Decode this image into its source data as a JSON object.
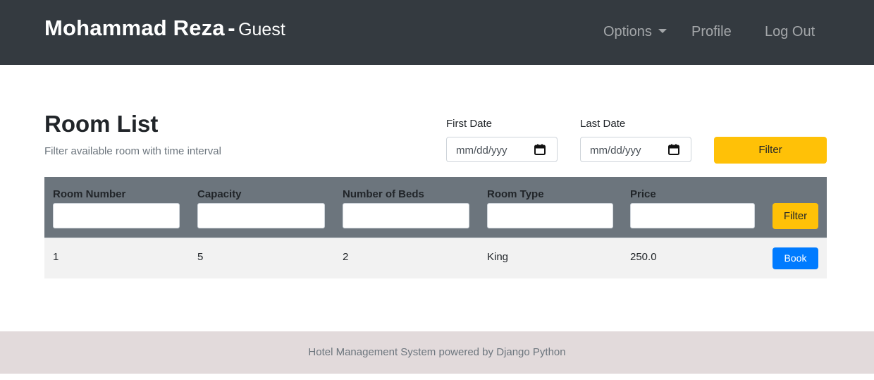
{
  "navbar": {
    "brand_name": "Mohammad Reza",
    "brand_separator": "-",
    "brand_role": "Guest",
    "options_label": "Options",
    "profile_label": "Profile",
    "logout_label": "Log Out"
  },
  "header": {
    "title": "Room List",
    "subtitle": "Filter available room with time interval"
  },
  "date_filter": {
    "first_label": "First Date",
    "first_value": "mm/dd/yyy",
    "last_label": "Last Date",
    "last_value": "mm/dd/yyy",
    "filter_label": "Filter"
  },
  "table": {
    "columns": [
      "Room Number",
      "Capacity",
      "Number of Beds",
      "Room Type",
      "Price"
    ],
    "filter_label": "Filter",
    "rows": [
      {
        "room_number": "1",
        "capacity": "5",
        "beds": "2",
        "room_type": "King",
        "price": "250.0",
        "action": "Book"
      }
    ]
  },
  "footer": {
    "text": "Hotel Management System powered by Django Python"
  },
  "colors": {
    "navbar": "#343a40",
    "warning": "#ffc107",
    "primary": "#007bff",
    "table_head": "#6c757d",
    "footer": "#e2dadb"
  },
  "icons": {
    "calendar": "calendar-icon",
    "caret": "caret-down-icon"
  }
}
